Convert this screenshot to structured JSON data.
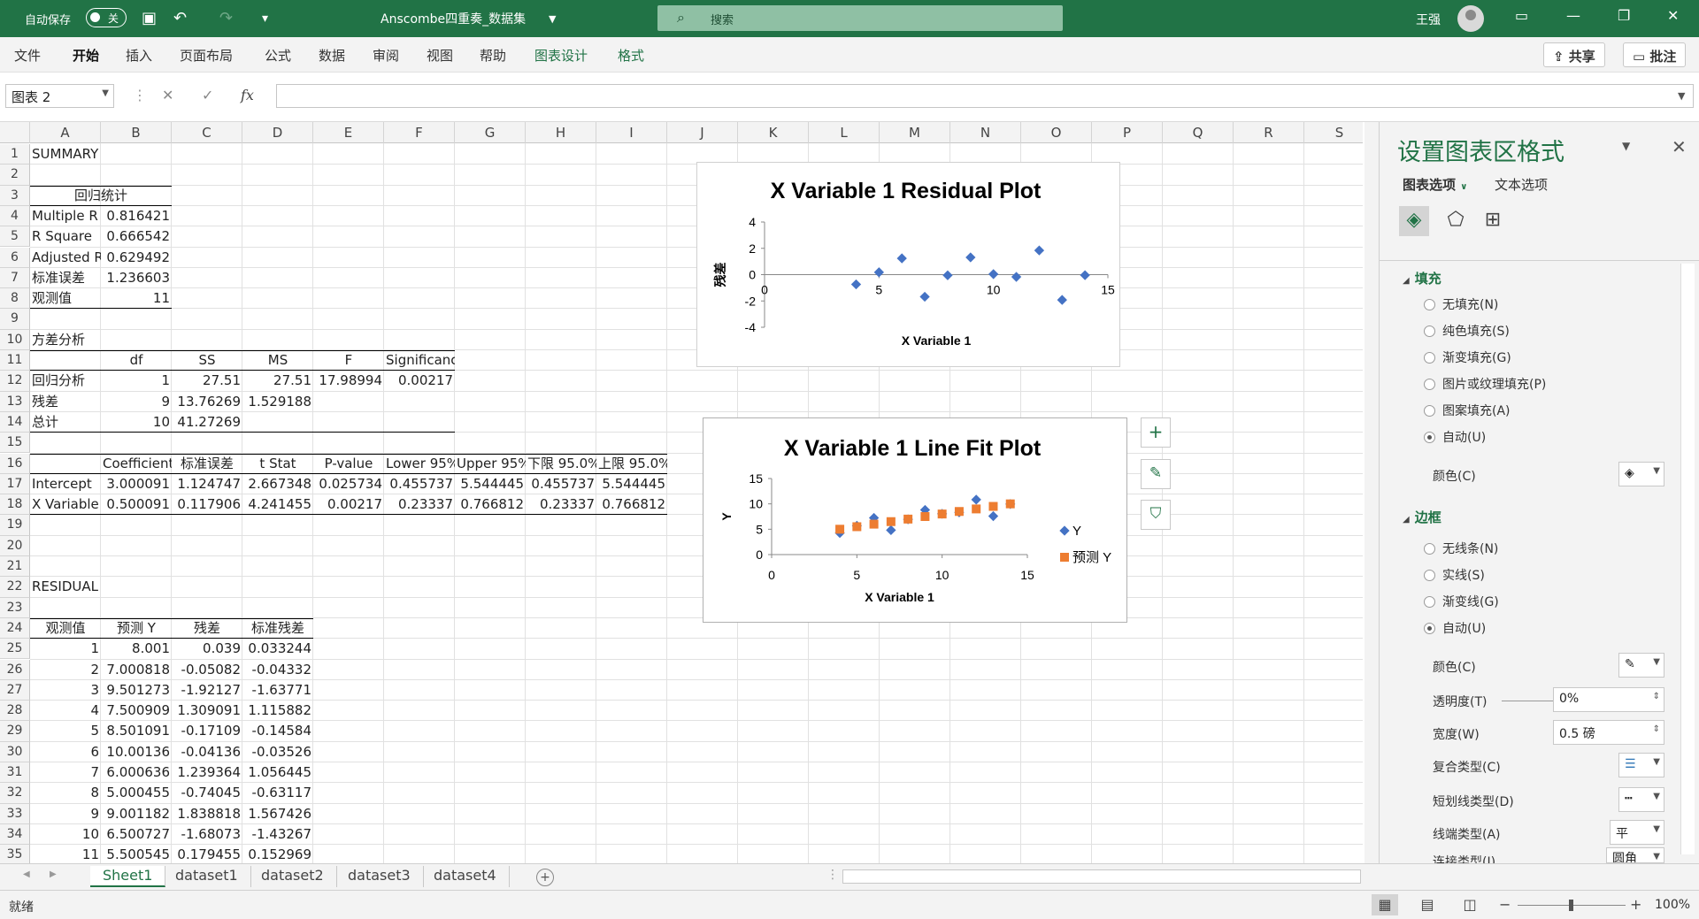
{
  "titlebar": {
    "autosave_label": "自动保存",
    "autosave_state": "关",
    "doc_title": "Anscombe四重奏_数据集",
    "search_placeholder": "搜索",
    "user_name": "王强",
    "theme_color": "#217346"
  },
  "ribbon": {
    "tabs": [
      "文件",
      "开始",
      "插入",
      "页面布局",
      "公式",
      "数据",
      "审阅",
      "视图",
      "帮助",
      "图表设计",
      "格式"
    ],
    "active_tab": "开始",
    "share_label": "共享",
    "comment_label": "批注"
  },
  "formula_bar": {
    "name_box": "图表 2",
    "cancel_icon": "✕",
    "enter_icon": "✓",
    "fx_label": "fx",
    "formula_value": ""
  },
  "grid": {
    "columns": [
      "A",
      "B",
      "C",
      "D",
      "E",
      "F",
      "G",
      "H",
      "I",
      "J",
      "K",
      "L",
      "M",
      "N",
      "O",
      "P",
      "Q",
      "R",
      "S"
    ],
    "rows": [
      1,
      2,
      3,
      4,
      5,
      6,
      7,
      8,
      9,
      10,
      11,
      12,
      13,
      14,
      15,
      16,
      17,
      18,
      19,
      20,
      21,
      22,
      23,
      24,
      25,
      26,
      27,
      28,
      29,
      30,
      31,
      32,
      33,
      34,
      35
    ],
    "summary": {
      "title": "SUMMARY OUTPUT",
      "reg_stats_header": "回归统计",
      "stats": [
        {
          "label": "Multiple R",
          "value": "0.816421"
        },
        {
          "label": "R Square",
          "value": "0.666542"
        },
        {
          "label": "Adjusted R",
          "value": "0.629492"
        },
        {
          "label": "标准误差",
          "value": "1.236603"
        },
        {
          "label": "观测值",
          "value": "11"
        }
      ]
    },
    "anova": {
      "title": "方差分析",
      "headers": [
        "",
        "df",
        "SS",
        "MS",
        "F",
        "Significance F"
      ],
      "rows": [
        [
          "回归分析",
          "1",
          "27.51",
          "27.51",
          "17.98994",
          "0.00217"
        ],
        [
          "残差",
          "9",
          "13.76269",
          "1.529188",
          "",
          ""
        ],
        [
          "总计",
          "10",
          "41.27269",
          "",
          "",
          ""
        ]
      ]
    },
    "coef": {
      "headers": [
        "",
        "Coefficients",
        "标准误差",
        "t Stat",
        "P-value",
        "Lower 95%",
        "Upper 95%",
        "下限 95.0%",
        "上限 95.0%"
      ],
      "rows": [
        [
          "Intercept",
          "3.000091",
          "1.124747",
          "2.667348",
          "0.025734",
          "0.455737",
          "5.544445",
          "0.455737",
          "5.544445"
        ],
        [
          "X Variable",
          "0.500091",
          "0.117906",
          "4.241455",
          "0.00217",
          "0.23337",
          "0.766812",
          "0.23337",
          "0.766812"
        ]
      ]
    },
    "residual": {
      "title": "RESIDUAL OUTPUT",
      "headers": [
        "观测值",
        "预测 Y",
        "残差",
        "标准残差"
      ],
      "rows": [
        [
          "1",
          "8.001",
          "0.039",
          "0.033244"
        ],
        [
          "2",
          "7.000818",
          "-0.05082",
          "-0.04332"
        ],
        [
          "3",
          "9.501273",
          "-1.92127",
          "-1.63771"
        ],
        [
          "4",
          "7.500909",
          "1.309091",
          "1.115882"
        ],
        [
          "5",
          "8.501091",
          "-0.17109",
          "-0.14584"
        ],
        [
          "6",
          "10.00136",
          "-0.04136",
          "-0.03526"
        ],
        [
          "7",
          "6.000636",
          "1.239364",
          "1.056445"
        ],
        [
          "8",
          "5.000455",
          "-0.74045",
          "-0.63117"
        ],
        [
          "9",
          "9.001182",
          "1.838818",
          "1.567426"
        ],
        [
          "10",
          "6.500727",
          "-1.68073",
          "-1.43267"
        ],
        [
          "11",
          "5.500545",
          "0.179455",
          "0.152969"
        ]
      ]
    }
  },
  "chart_data": [
    {
      "type": "scatter",
      "title": "X Variable 1 Residual Plot",
      "xlabel": "X Variable 1",
      "ylabel": "残差",
      "xlim": [
        0,
        15
      ],
      "ylim": [
        -4,
        4
      ],
      "xticks": [
        0,
        5,
        10,
        15
      ],
      "yticks": [
        4,
        2,
        0,
        -2,
        -4
      ],
      "series": [
        {
          "x": [
            10,
            8,
            13,
            9,
            11,
            14,
            6,
            4,
            12,
            7,
            5
          ],
          "y": [
            0.039,
            -0.05082,
            -1.92127,
            1.309091,
            -0.17109,
            -0.04136,
            1.239364,
            -0.74045,
            1.838818,
            -1.68073,
            0.179455
          ],
          "color": "#4472c4"
        }
      ]
    },
    {
      "type": "scatter",
      "title": "X Variable 1 Line Fit  Plot",
      "xlabel": "X Variable 1",
      "ylabel": "Y",
      "xlim": [
        0,
        15
      ],
      "ylim": [
        0,
        15
      ],
      "xticks": [
        0,
        5,
        10,
        15
      ],
      "yticks": [
        15,
        10,
        5,
        0
      ],
      "legend": "right",
      "series": [
        {
          "name": "Y",
          "x": [
            10,
            8,
            13,
            9,
            11,
            14,
            6,
            4,
            12,
            7,
            5
          ],
          "y": [
            8.04,
            6.95,
            7.58,
            8.81,
            8.33,
            9.96,
            7.24,
            4.26,
            10.84,
            4.82,
            5.68
          ],
          "color": "#4472c4"
        },
        {
          "name": "预测 Y",
          "x": [
            10,
            8,
            13,
            9,
            11,
            14,
            6,
            4,
            12,
            7,
            5
          ],
          "y": [
            8.001,
            7.000818,
            9.501273,
            7.500909,
            8.501091,
            10.00136,
            6.000636,
            5.000455,
            9.001182,
            6.500727,
            5.500545
          ],
          "color": "#ed7d31"
        }
      ]
    }
  ],
  "format_pane": {
    "title": "设置图表区格式",
    "tab_chart_options": "图表选项",
    "tab_text_options": "文本选项",
    "fill_section": "填充",
    "fill_options": [
      "无填充(N)",
      "纯色填充(S)",
      "渐变填充(G)",
      "图片或纹理填充(P)",
      "图案填充(A)",
      "自动(U)"
    ],
    "fill_selected": "自动(U)",
    "fill_color_label": "颜色(C)",
    "border_section": "边框",
    "border_options": [
      "无线条(N)",
      "实线(S)",
      "渐变线(G)",
      "自动(U)"
    ],
    "border_selected": "自动(U)",
    "border_color_label": "颜色(C)",
    "transparency_label": "透明度(T)",
    "transparency_value": "0%",
    "width_label": "宽度(W)",
    "width_value": "0.5 磅",
    "compound_label": "复合类型(C)",
    "dash_label": "短划线类型(D)",
    "cap_label": "线端类型(A)",
    "cap_value": "平",
    "join_label": "连接类型(J)",
    "join_value": "圆角"
  },
  "sheets": {
    "tabs": [
      "Sheet1",
      "dataset1",
      "dataset2",
      "dataset3",
      "dataset4"
    ],
    "active": "Sheet1"
  },
  "status": {
    "ready": "就绪",
    "zoom": "100%"
  }
}
